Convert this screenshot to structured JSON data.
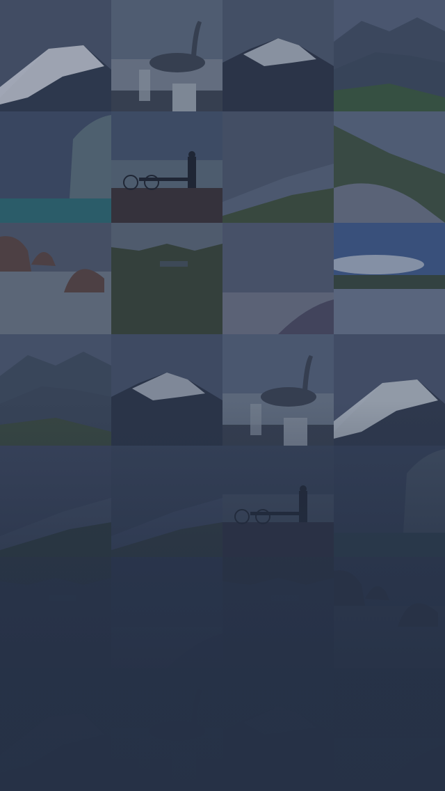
{
  "screen": {
    "background": "#27324a",
    "overlay_color": "#263146"
  },
  "photo_grid": {
    "columns": 4,
    "tiles": [
      {
        "scene": "snowy-peak",
        "palette": [
          "#4a556a",
          "#dfe3ea",
          "#2f3a4c"
        ]
      },
      {
        "scene": "pelican-pier",
        "palette": [
          "#5d6a7c",
          "#9aa3ad",
          "#3b4350"
        ]
      },
      {
        "scene": "snowy-mountain",
        "palette": [
          "#4d596d",
          "#c9cfd8",
          "#2c3546"
        ]
      },
      {
        "scene": "mountain-ridges",
        "palette": [
          "#56627a",
          "#3d4a5c",
          "#3b5a3e"
        ]
      },
      {
        "scene": "sea-rock",
        "palette": [
          "#3f4d66",
          "#5b6f7a",
          "#2d6a72"
        ]
      },
      {
        "scene": "man-bicycle",
        "palette": [
          "#45536b",
          "#5a6a78",
          "#3a3236"
        ]
      },
      {
        "scene": "green-hill",
        "palette": [
          "#4c576b",
          "#59657a",
          "#3e4f3a"
        ]
      },
      {
        "scene": "coastal-road",
        "palette": [
          "#5d6a80",
          "#3f5241",
          "#6b7384"
        ]
      },
      {
        "scene": "sea-stacks",
        "palette": [
          "#4f596b",
          "#6d7785",
          "#5a4540"
        ]
      },
      {
        "scene": "valley-lake",
        "palette": [
          "#4a566a",
          "#384536",
          "#5d6977"
        ]
      },
      {
        "scene": "misty-beach",
        "palette": [
          "#525b70",
          "#6c7283",
          "#4b4a61"
        ]
      },
      {
        "scene": "lake-clouds",
        "palette": [
          "#3f5a8a",
          "#a3afc2",
          "#37473d"
        ]
      },
      {
        "scene": "mountain-ridges",
        "palette": [
          "#4e5a70",
          "#3c485a",
          "#3d4d3d"
        ]
      },
      {
        "scene": "snowy-mountain",
        "palette": [
          "#465268",
          "#b9c0ca",
          "#2b3446"
        ]
      },
      {
        "scene": "pelican-pier",
        "palette": [
          "#56637a",
          "#8c96a2",
          "#3a4251"
        ]
      },
      {
        "scene": "snowy-peak",
        "palette": [
          "#4a556c",
          "#cdd3db",
          "#303a4d"
        ]
      },
      {
        "scene": "green-hill",
        "palette": [
          "#3f4a60",
          "#48556a",
          "#2f3f37"
        ]
      },
      {
        "scene": "green-hill",
        "palette": [
          "#3b475d",
          "#44506a",
          "#34403c"
        ]
      },
      {
        "scene": "man-bicycle",
        "palette": [
          "#3b475d",
          "#4a5668",
          "#323040"
        ]
      },
      {
        "scene": "sea-rock",
        "palette": [
          "#37435a",
          "#475566",
          "#2f4650"
        ]
      },
      {
        "scene": "valley-lake",
        "palette": [
          "#323e55",
          "#2f3a4c",
          "#2f3a40"
        ]
      },
      {
        "scene": "misty-beach",
        "palette": [
          "#313c54",
          "#364158",
          "#2f3850"
        ]
      },
      {
        "scene": "valley-lake",
        "palette": [
          "#313c54",
          "#2e394c",
          "#2d3640"
        ]
      },
      {
        "scene": "sea-stacks",
        "palette": [
          "#323e55",
          "#384459",
          "#2f3442"
        ]
      },
      {
        "scene": "snowy-peak",
        "palette": [
          "#2d384e",
          "#37425a",
          "#2b3445"
        ]
      },
      {
        "scene": "pelican-pier",
        "palette": [
          "#2d384e",
          "#333e55",
          "#2b3344"
        ]
      },
      {
        "scene": "snowy-mountain",
        "palette": [
          "#2d384e",
          "#343f56",
          "#2a3344"
        ]
      },
      {
        "scene": "misty-beach",
        "palette": [
          "#2c374d",
          "#313c53",
          "#2a3344"
        ]
      }
    ]
  }
}
